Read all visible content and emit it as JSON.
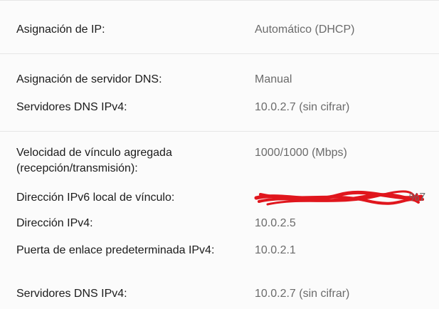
{
  "network_properties": {
    "ip_assignment": {
      "label": "Asignación de IP:",
      "value": "Automático (DHCP)"
    },
    "dns_assignment": {
      "label": "Asignación de servidor DNS:",
      "value": "Manual"
    },
    "dns_servers_ipv4_a": {
      "label": "Servidores DNS IPv4:",
      "value": "10.0.2.7 (sin cifrar)"
    },
    "link_speed": {
      "label": "Velocidad de vínculo agregada (recepción/transmisión):",
      "value": "1000/1000 (Mbps)"
    },
    "ipv6_link_local": {
      "label": "Dirección IPv6 local de vínculo:",
      "value_visible_tail": "%7"
    },
    "ipv4_address": {
      "label": "Dirección IPv4:",
      "value": "10.0.2.5"
    },
    "ipv4_gateway": {
      "label": "Puerta de enlace predeterminada IPv4:",
      "value": "10.0.2.1"
    },
    "dns_servers_ipv4_b": {
      "label": "Servidores DNS IPv4:",
      "value": "10.0.2.7 (sin cifrar)"
    }
  },
  "colors": {
    "background": "#fbfbfb",
    "divider": "#e6e6e6",
    "label_text": "#1b1b1b",
    "value_text": "#6b6b6b",
    "redaction": "#e0161d"
  }
}
